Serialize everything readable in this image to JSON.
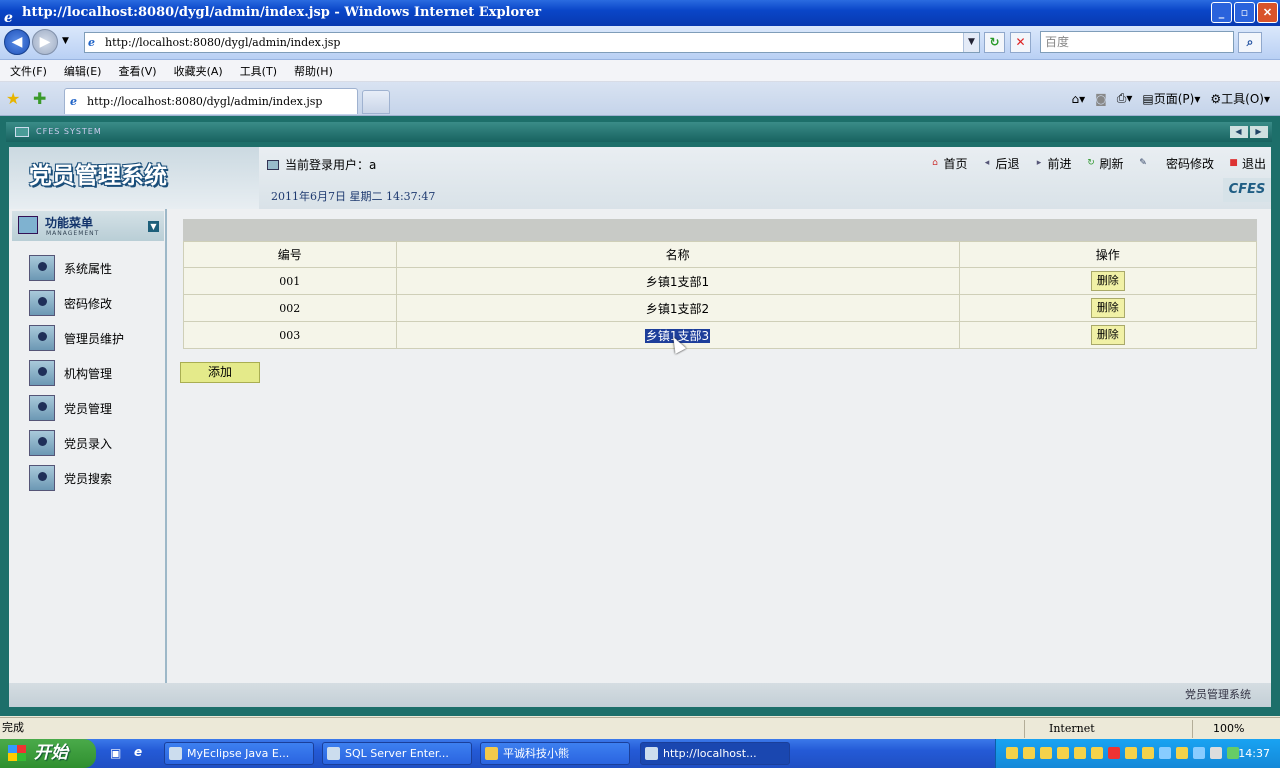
{
  "window": {
    "title": "http://localhost:8080/dygl/admin/index.jsp - Windows Internet Explorer",
    "address": "http://localhost:8080/dygl/admin/index.jsp",
    "search_placeholder": "百度"
  },
  "ie_menu": [
    "文件(F)",
    "编辑(E)",
    "查看(V)",
    "收藏夹(A)",
    "工具(T)",
    "帮助(H)"
  ],
  "tab": {
    "label": "http://localhost:8080/dygl/admin/index.jsp"
  },
  "command_bar": {
    "page": "页面(P)",
    "tools": "工具(O)"
  },
  "app": {
    "system_tag": "CFES SYSTEM",
    "brand": "党员管理系统",
    "current_user": "当前登录用户：a",
    "datetime": "2011年6月7日  星期二  14:37:47",
    "nav": [
      "首页",
      "后退",
      "前进",
      "刷新",
      "密码修改",
      "退出"
    ],
    "cfes_logo": "CFES",
    "menu_title": "功能菜单",
    "menu_subtitle": "MANAGEMENT",
    "menu_items": [
      "系统属性",
      "密码修改",
      "管理员维护",
      "机构管理",
      "党员管理",
      "党员录入",
      "党员搜索"
    ],
    "table": {
      "headers": [
        "编号",
        "名称",
        "操作"
      ],
      "rows": [
        {
          "id": "001",
          "name": "乡镇1支部1",
          "action": "删除"
        },
        {
          "id": "002",
          "name": "乡镇1支部2",
          "action": "删除"
        },
        {
          "id": "003",
          "name": "乡镇1支部3",
          "action": "删除"
        }
      ]
    },
    "add_button": "添加",
    "footer": "党员管理系统"
  },
  "statusbar": {
    "status": "完成",
    "zone": "Internet",
    "zoom": "100%"
  },
  "taskbar": {
    "start": "开始",
    "tasks": [
      "MyEclipse Java E...",
      "SQL Server Enter...",
      "平诚科技小熊",
      "http://localhost..."
    ],
    "clock": "14:37"
  }
}
